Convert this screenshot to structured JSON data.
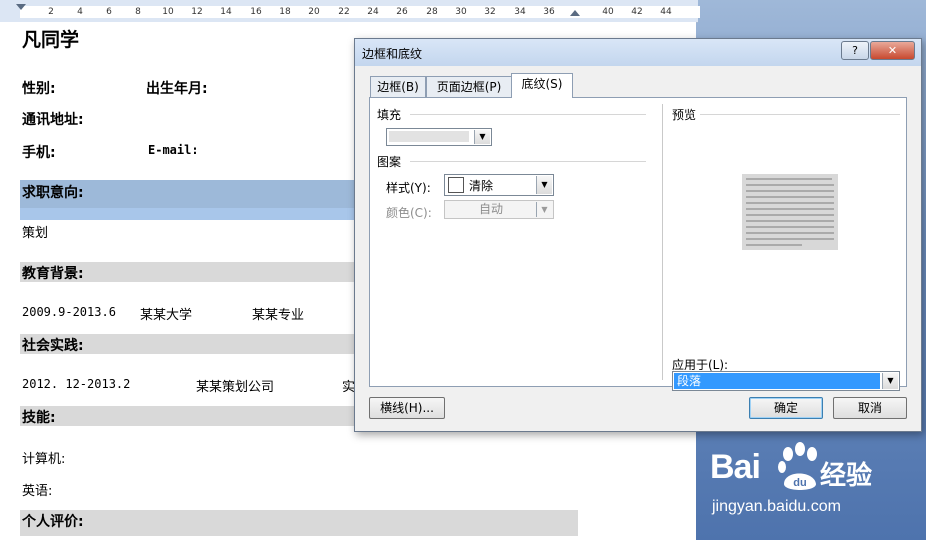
{
  "ruler": {
    "labels": [
      "2",
      "4",
      "6",
      "8",
      "10",
      "12",
      "14",
      "16",
      "18",
      "20",
      "22",
      "24",
      "26",
      "28",
      "30",
      "32",
      "34",
      "36",
      "40",
      "42",
      "44"
    ]
  },
  "doc": {
    "title": "凡同学",
    "gender_label": "性别:",
    "birth_label": "出生年月:",
    "address_label": "通讯地址:",
    "phone_label": "手机:",
    "email_label": "E-mail:",
    "sections": {
      "job_intent": "求职意向:",
      "job_value": "策划",
      "education": "教育背景:",
      "edu_period": "2009.9-2013.6",
      "edu_school": "某某大学",
      "edu_major": "某某专业",
      "practice": "社会实践:",
      "prac_period": "2012. 12-2013.2",
      "prac_company": "某某策划公司",
      "prac_extra": "实",
      "skills": "技能:",
      "skill_computer": "计算机:",
      "skill_english": "英语:",
      "evaluation": "个人评价:"
    }
  },
  "dialog": {
    "title": "边框和底纹",
    "help": "?",
    "close": "✕",
    "tabs": [
      {
        "label": "边框(B)"
      },
      {
        "label": "页面边框(P)"
      },
      {
        "label": "底纹(S)"
      }
    ],
    "fill_label": "填充",
    "pattern_label": "图案",
    "style_label": "样式(Y):",
    "style_value": "清除",
    "color_label": "颜色(C):",
    "color_value": "自动",
    "preview_label": "预览",
    "apply_label": "应用于(L):",
    "apply_value": "段落",
    "horizontal_line_button": "横线(H)...",
    "ok_button": "确定",
    "cancel_button": "取消"
  },
  "watermark": {
    "logo_text": "Bai",
    "logo_cn": "经验",
    "url": "jingyan.baidu.com",
    "paw_text": "du"
  }
}
